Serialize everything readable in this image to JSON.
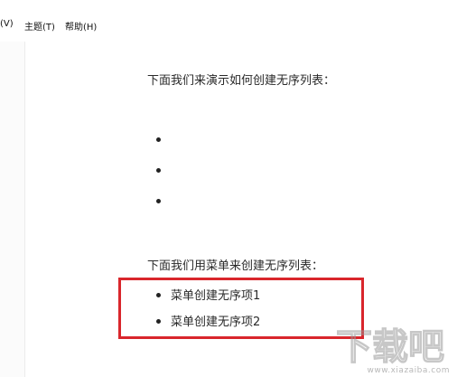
{
  "menu": {
    "items": [
      {
        "label": "(V)"
      },
      {
        "label": "主题(T)"
      },
      {
        "label": "帮助(H)"
      }
    ]
  },
  "content": {
    "heading1": "下面我们来演示如何创建无序列表：",
    "heading2": "下面我们用菜单来创建无序列表：",
    "menu_list_items": [
      "菜单创建无序项1",
      "菜单创建无序项2"
    ]
  },
  "watermark": {
    "logo_text": "下载吧",
    "url": "www.xiazaiba.com"
  },
  "colors": {
    "highlight": "#d9262c"
  }
}
